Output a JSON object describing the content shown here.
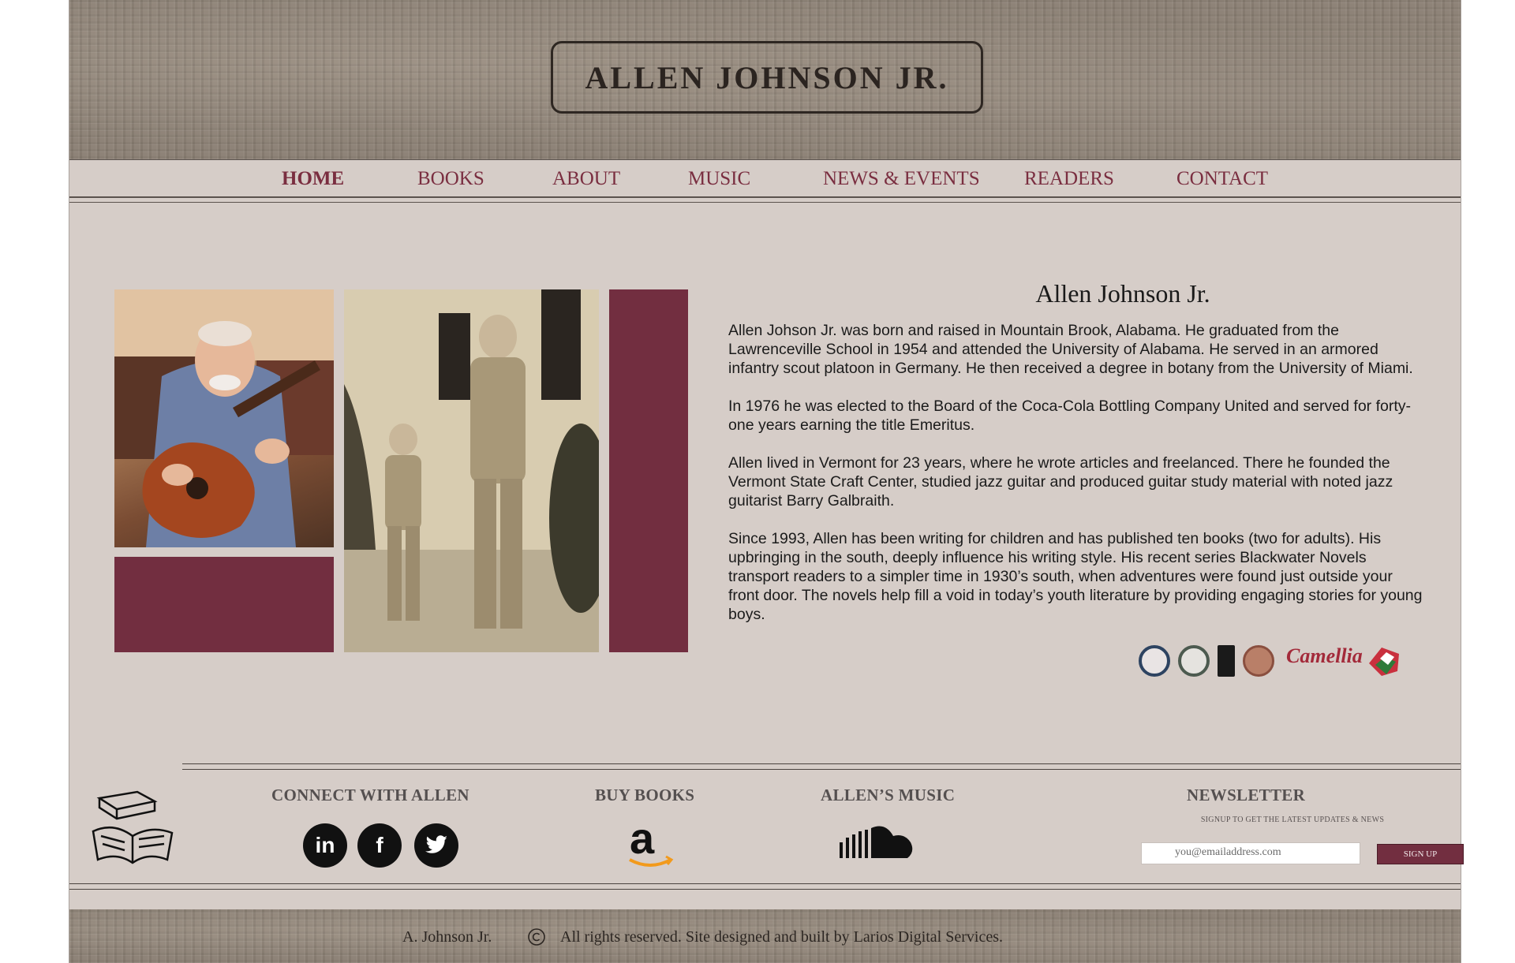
{
  "header": {
    "logo_text": "ALLEN JOHNSON JR."
  },
  "nav": {
    "items": [
      {
        "label": "HOME"
      },
      {
        "label": "BOOKS"
      },
      {
        "label": "ABOUT"
      },
      {
        "label": "MUSIC"
      },
      {
        "label": "NEWS & EVENTS"
      },
      {
        "label": "READERS"
      },
      {
        "label": "CONTACT"
      }
    ]
  },
  "about": {
    "title": "Allen Johnson Jr.",
    "paragraphs": [
      "Allen Johson Jr. was born and raised in Mountain Brook, Alabama. He graduated from the Lawrenceville School in 1954 and attended the University of Alabama. He served in an armored infantry scout platoon in Germany.  He then received a degree in botany from the University of Miami.",
      "In 1976 he was elected to the Board of the Coca-Cola Bottling Company United and served for forty-one years earning the title Emeritus.",
      "Allen lived in Vermont for 23 years, where he wrote articles and freelanced. There he founded the Vermont State Craft Center, studied jazz guitar and produced guitar study material with noted jazz guitarist Barry Galbraith.",
      "Since 1993, Allen has been writing for children and has published ten books (two for adults). His upbringing in the south, deeply influence his writing style. His recent series Blackwater Novels transport readers to a simpler time in 1930’s south, when adventures were found just outside your front door. The novels help fill a void in today’s youth literature by providing engaging stories for young boys."
    ]
  },
  "footer": {
    "connect_heading": "CONNECT WITH ALLEN",
    "buy_heading": "BUY BOOKS",
    "music_heading": "ALLEN’S MUSIC",
    "newsletter_heading": "NEWSLETTER",
    "newsletter_subtext": "SIGNUP TO GET THE LATEST UPDATES & NEWS",
    "email_placeholder": "you@emailaddress.com",
    "signup_label": "SIGN UP",
    "social_icons": [
      "linkedin-icon",
      "facebook-icon",
      "twitter-icon"
    ]
  },
  "bottom": {
    "name": "A. Johnson Jr.",
    "rights": "All rights reserved. Site designed and built by Larios Digital Services."
  },
  "colors": {
    "accent": "#722e40",
    "page_bg": "#d6cdc8",
    "texture": "#8c8175"
  }
}
